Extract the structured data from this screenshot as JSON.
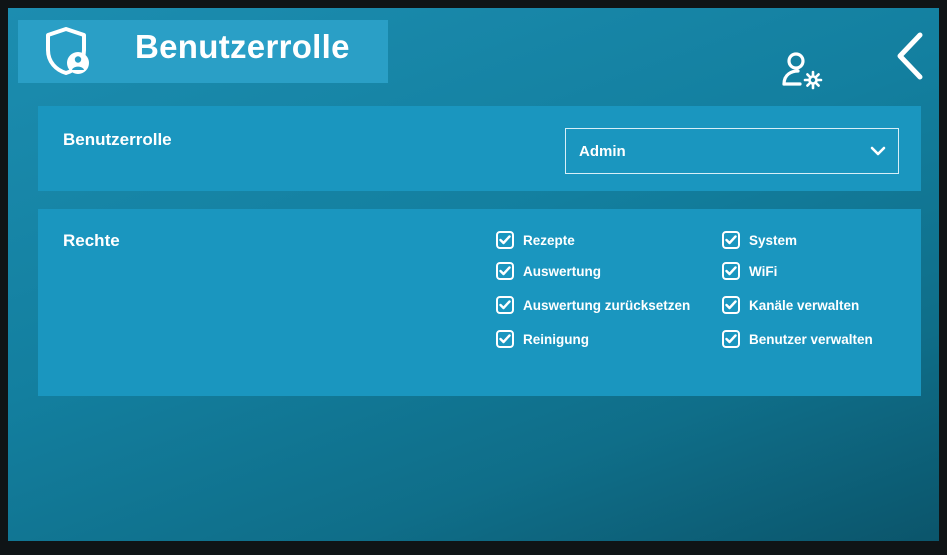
{
  "header": {
    "title": "Benutzerrolle",
    "icons": [
      "shield-user-icon",
      "user-settings-icon",
      "back-chevron-icon"
    ]
  },
  "role_panel": {
    "label": "Benutzerrolle",
    "select_value": "Admin"
  },
  "rights_panel": {
    "label": "Rechte",
    "permissions_left": [
      {
        "label": "Rezepte",
        "checked": true
      },
      {
        "label": "Auswertung",
        "checked": true
      },
      {
        "label": "Auswertung zurücksetzen",
        "checked": true
      },
      {
        "label": "Reinigung",
        "checked": true
      }
    ],
    "permissions_right": [
      {
        "label": "System",
        "checked": true
      },
      {
        "label": "WiFi",
        "checked": true
      },
      {
        "label": "Kanäle verwalten",
        "checked": true
      },
      {
        "label": "Benutzer verwalten",
        "checked": true
      }
    ]
  },
  "colors": {
    "background": "#137f9f",
    "panel": "#1a96bf",
    "title_box": "#2a9fc6",
    "text": "#ffffff"
  }
}
